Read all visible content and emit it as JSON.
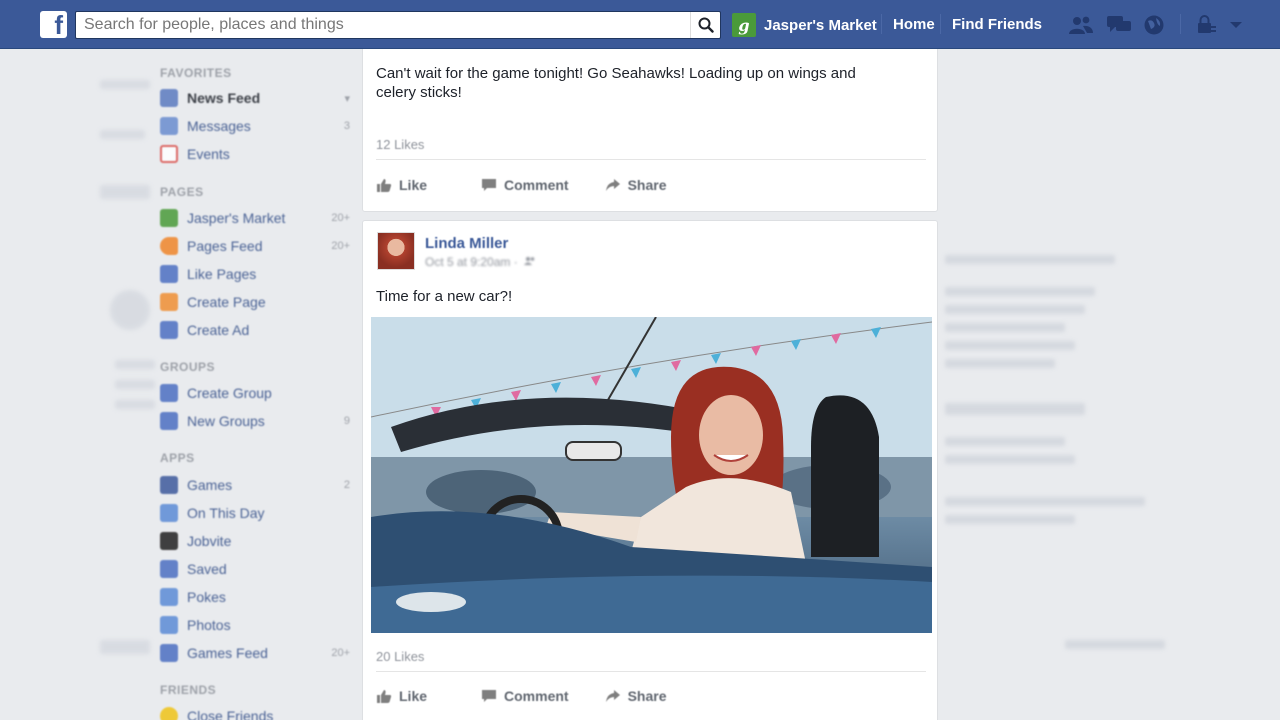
{
  "topbar": {
    "logo": "f",
    "search_placeholder": "Search for people, places and things",
    "page_name": "Jasper's Market",
    "page_initial": "g",
    "home": "Home",
    "find_friends": "Find Friends"
  },
  "sidebar": {
    "favorites": {
      "heading": "FAVORITES",
      "items": [
        {
          "label": "News Feed",
          "count": "▾",
          "icon_color": "#5b7bc0"
        },
        {
          "label": "Messages",
          "count": "3",
          "icon_color": "#6a8ccf"
        },
        {
          "label": "Events",
          "count": "",
          "icon_color": "#d9534f"
        }
      ]
    },
    "pages": {
      "heading": "PAGES",
      "items": [
        {
          "label": "Jasper's Market",
          "count": "20+",
          "icon_color": "#4a9a3a"
        },
        {
          "label": "Pages Feed",
          "count": "20+",
          "icon_color": "#f0862b"
        },
        {
          "label": "Like Pages",
          "count": "",
          "icon_color": "#4c6fc2"
        },
        {
          "label": "Create Page",
          "count": "",
          "icon_color": "#f08f34"
        },
        {
          "label": "Create Ad",
          "count": "",
          "icon_color": "#4c6fc2"
        }
      ]
    },
    "groups": {
      "heading": "GROUPS",
      "items": [
        {
          "label": "Create Group",
          "count": "",
          "icon_color": "#4c6fc2"
        },
        {
          "label": "New Groups",
          "count": "9",
          "icon_color": "#4c6fc2"
        }
      ]
    },
    "apps": {
      "heading": "APPS",
      "items": [
        {
          "label": "Games",
          "count": "2",
          "icon_color": "#3e5a9c"
        },
        {
          "label": "On This Day",
          "count": "",
          "icon_color": "#5b8bd6"
        },
        {
          "label": "Jobvite",
          "count": "",
          "icon_color": "#222222"
        },
        {
          "label": "Saved",
          "count": "",
          "icon_color": "#4c6fc2"
        },
        {
          "label": "Pokes",
          "count": "",
          "icon_color": "#5b8bd6"
        },
        {
          "label": "Photos",
          "count": "",
          "icon_color": "#5b8bd6"
        },
        {
          "label": "Games Feed",
          "count": "20+",
          "icon_color": "#4c6fc2"
        }
      ]
    },
    "friends": {
      "heading": "FRIENDS",
      "items": [
        {
          "label": "Close Friends",
          "count": "",
          "icon_color": "#f0c419"
        }
      ]
    }
  },
  "feed": {
    "post1": {
      "text": "Can't wait for the game tonight! Go Seahawks! Loading up on wings and celery sticks!",
      "likes": "12 Likes",
      "like": "Like",
      "comment": "Comment",
      "share": "Share"
    },
    "post2": {
      "author": "Linda Miller",
      "meta": "Oct 5 at 9:20am ·",
      "text": "Time for a new car?!",
      "likes": "20 Likes",
      "like": "Like",
      "comment": "Comment",
      "share": "Share"
    }
  }
}
